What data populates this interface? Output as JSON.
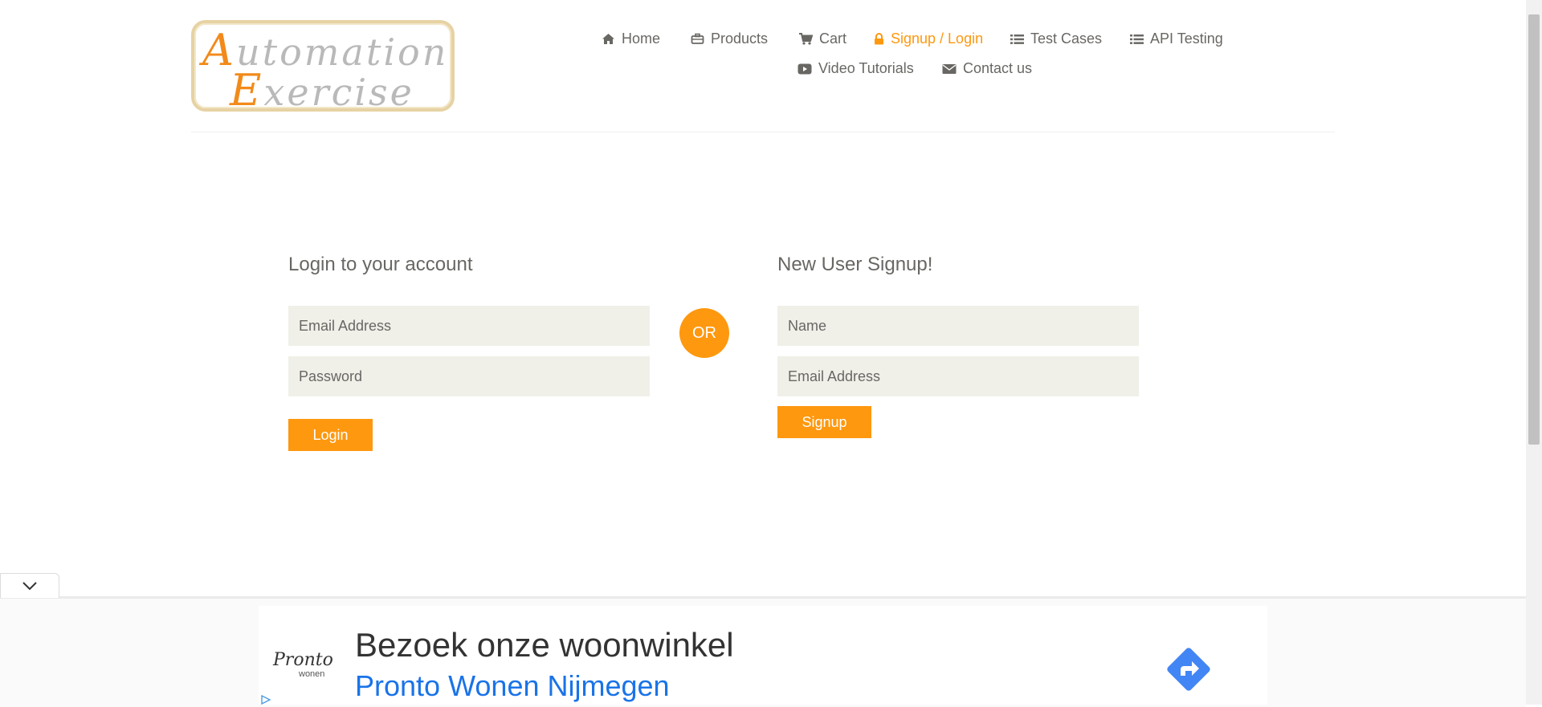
{
  "logo": {
    "line1": "Automation",
    "line2": "Exercise"
  },
  "nav": {
    "home": "Home",
    "products": "Products",
    "cart": "Cart",
    "signup_login": "Signup / Login",
    "test_cases": "Test Cases",
    "api_testing": "API Testing",
    "video_tutorials": "Video Tutorials",
    "contact_us": "Contact us"
  },
  "login": {
    "title": "Login to your account",
    "email_placeholder": "Email Address",
    "password_placeholder": "Password",
    "button": "Login"
  },
  "or_label": "OR",
  "signup": {
    "title": "New User Signup!",
    "name_placeholder": "Name",
    "email_placeholder": "Email Address",
    "button": "Signup"
  },
  "ad": {
    "brand": "Pronto",
    "brand_sub": "wonen",
    "headline": "Bezoek onze woonwinkel",
    "link": "Pronto Wonen Nijmegen"
  },
  "colors": {
    "accent": "#fe980f",
    "field_bg": "#f0f0e9",
    "text": "#696763",
    "ad_link": "#1a73e8"
  },
  "icons": [
    "home-icon",
    "briefcase-icon",
    "cart-icon",
    "lock-icon",
    "list-icon",
    "youtube-icon",
    "envelope-icon",
    "chevron-down-icon",
    "directions-icon",
    "adchoices-icon"
  ]
}
